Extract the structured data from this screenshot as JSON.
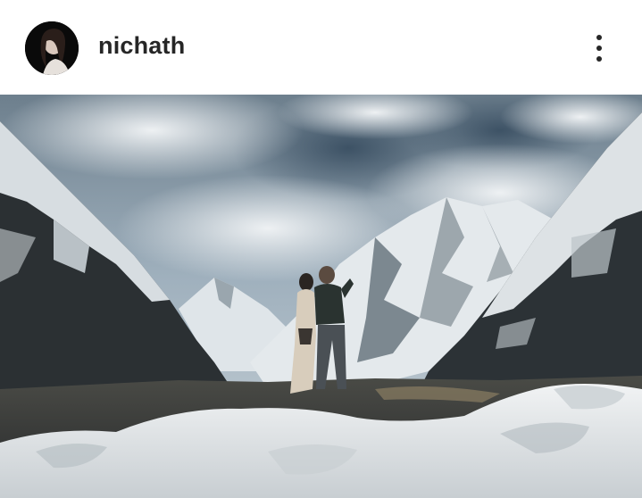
{
  "post": {
    "username": "nichath",
    "avatar": "profile-photo",
    "more_icon": "more-options-icon",
    "image": "mountain-valley-photo",
    "colors": {
      "username_text": "#262626",
      "background": "#ffffff",
      "sky": "#8fa3b2",
      "snow": "#e8ecef",
      "rock": "#2d3236"
    }
  }
}
